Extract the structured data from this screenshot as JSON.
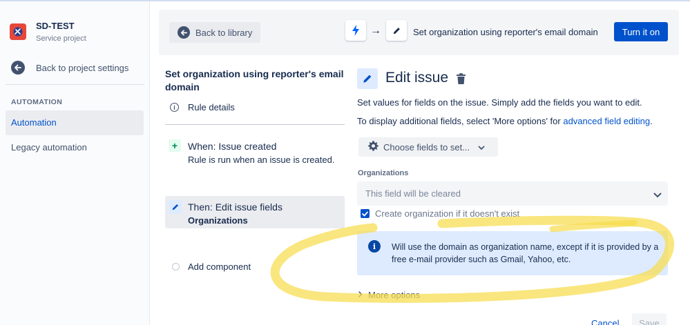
{
  "sidebar": {
    "project_name": "SD-TEST",
    "project_type": "Service project",
    "back_label": "Back to project settings",
    "section_heading": "AUTOMATION",
    "items": [
      {
        "label": "Automation",
        "active": true
      },
      {
        "label": "Legacy automation",
        "active": false
      }
    ]
  },
  "topbar": {
    "back_label": "Back to library",
    "trigger_icon": "lightning-icon",
    "action_icon": "pencil-icon",
    "rule_title": "Set organization using reporter's email domain",
    "turn_on_label": "Turn it on"
  },
  "rule": {
    "heading": "Set organization using reporter's email domain",
    "details_label": "Rule details",
    "trigger_title": "When: Issue created",
    "trigger_subtitle": "Rule is run when an issue is created.",
    "action_title": "Then: Edit issue fields",
    "action_subtitle": "Organizations",
    "add_component_label": "Add component"
  },
  "panel": {
    "title": "Edit issue",
    "desc1": "Set values for fields on the issue. Simply add the fields you want to edit.",
    "desc2_prefix": "To display additional fields, select 'More options' for ",
    "desc2_link": "advanced field editing",
    "desc2_suffix": ".",
    "choose_fields_label": "Choose fields to set...",
    "org_label": "Organizations",
    "org_placeholder": "This field will be cleared",
    "checkbox_label": "Create organization if it doesn't exist",
    "checkbox_checked": true,
    "info_text": "Will use the domain as organization name, except if it is provided by a free e-mail provider such as Gmail, Yahoo, etc.",
    "more_options_label": "More options",
    "cancel_label": "Cancel",
    "save_label": "Save"
  },
  "colors": {
    "primary": "#0052cc",
    "highlight": "#f7dc4c",
    "info_bg": "#deebff"
  }
}
